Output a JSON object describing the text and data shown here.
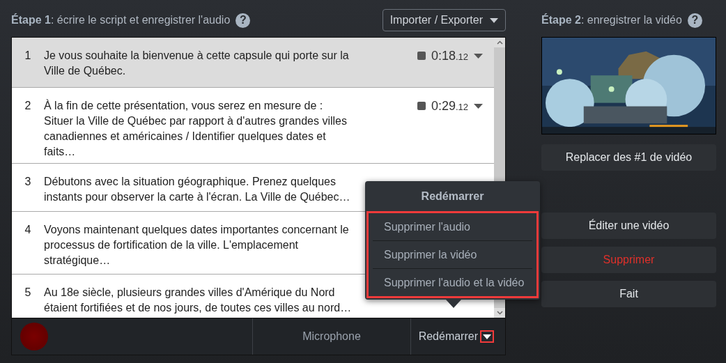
{
  "step1": {
    "label": "Étape 1",
    "text": ": écrire le script et enregistrer l'audio",
    "help": "?"
  },
  "import_export": {
    "label": "Importer / Exporter"
  },
  "rows": [
    {
      "number": "1",
      "text": "Je vous souhaite la bienvenue à cette capsule qui porte sur la Ville de Québec.",
      "time": "0:18",
      "fraction": ".12",
      "selected": true
    },
    {
      "number": "2",
      "text": "À la fin de cette présentation, vous serez en mesure de : Situer la Ville de Québec par rapport à d'autres grandes villes canadiennes et américaines / Identifier quelques dates et faits…",
      "time": "0:29",
      "fraction": ".12",
      "selected": false
    },
    {
      "number": "3",
      "text": "Débutons avec la situation géographique. Prenez quelques instants pour observer la carte à l'écran. La Ville de Québec…",
      "selected": false
    },
    {
      "number": "4",
      "text": "Voyons maintenant quelques dates importantes concernant le processus de fortification de la ville. L'emplacement stratégique…",
      "selected": false
    },
    {
      "number": "5",
      "text": "Au 18e siècle, plusieurs grandes villes d'Amérique du Nord étaient fortifiées et de nos jours, de toutes ces villes au nord…",
      "selected": false
    }
  ],
  "footer": {
    "microphone": "Microphone",
    "restart": "Redémarrer"
  },
  "popover": {
    "title": "Redémarrer",
    "items": [
      "Supprimer l'audio",
      "Supprimer la vidéo",
      "Supprimer l'audio et la vidéo"
    ]
  },
  "step2": {
    "label": "Étape 2",
    "text": ": enregistrer la vidéo",
    "help": "?"
  },
  "buttons": [
    {
      "label": "Replacer des #1 de vidéo",
      "kind": "normal"
    },
    {
      "label": "Éditer une vidéo",
      "kind": "normal"
    },
    {
      "label": "Supprimer",
      "kind": "danger"
    },
    {
      "label": "Fait",
      "kind": "normal"
    }
  ]
}
